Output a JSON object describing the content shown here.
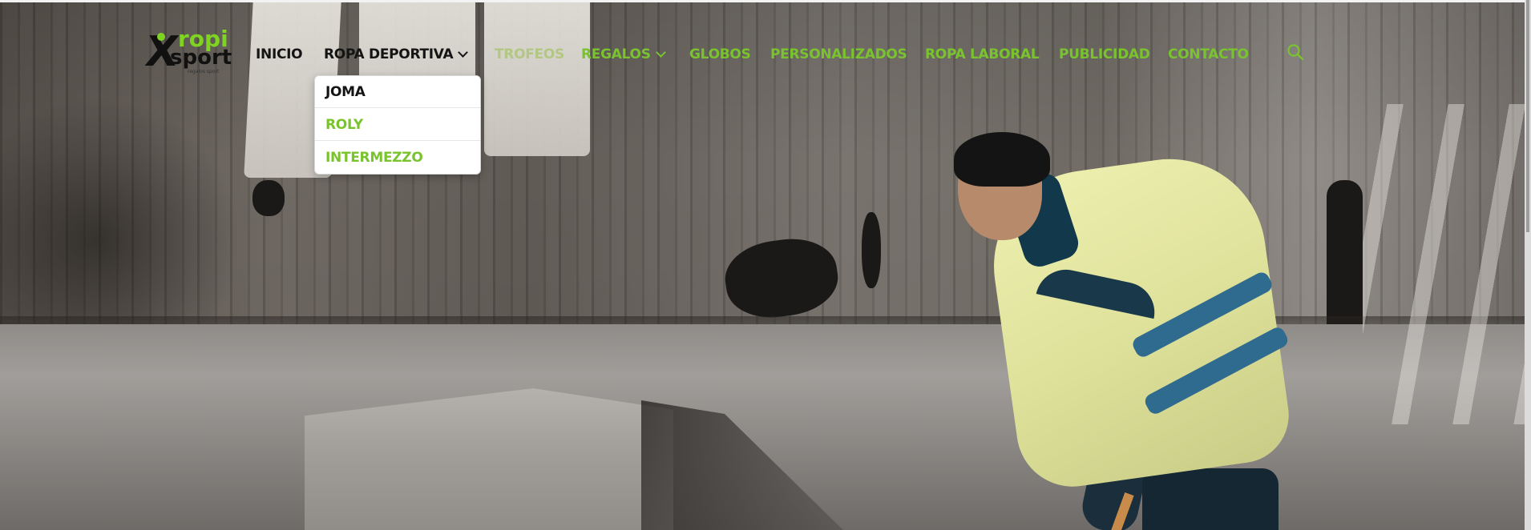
{
  "brand": {
    "logo_letter": "X",
    "logo_ropi": "ropi",
    "logo_sport": "sport",
    "logo_tagline": "regalos sport"
  },
  "nav": {
    "items": [
      {
        "label": "INICIO",
        "color": "#141414",
        "has_dropdown": false
      },
      {
        "label": "ROPA DEPORTIVA",
        "color": "#141414",
        "has_dropdown": true
      },
      {
        "label": "TROFEOS",
        "color": "#a7c46a",
        "has_dropdown": false
      },
      {
        "label": "REGALOS",
        "color": "#79c42e",
        "has_dropdown": true
      },
      {
        "label": "GLOBOS",
        "color": "#79c42e",
        "has_dropdown": false
      },
      {
        "label": "PERSONALIZADOS",
        "color": "#79c42e",
        "has_dropdown": false
      },
      {
        "label": "ROPA LABORAL",
        "color": "#79c42e",
        "has_dropdown": false
      },
      {
        "label": "PUBLICIDAD",
        "color": "#79c42e",
        "has_dropdown": false
      },
      {
        "label": "CONTACTO",
        "color": "#79c42e",
        "has_dropdown": false
      }
    ],
    "search_icon": "search-icon"
  },
  "dropdown": {
    "parent": "ROPA DEPORTIVA",
    "items": [
      {
        "label": "JOMA",
        "color": "#141414"
      },
      {
        "label": "ROLY",
        "color": "#79c42e"
      },
      {
        "label": "INTERMEZZO",
        "color": "#79c42e"
      }
    ]
  },
  "colors": {
    "accent_green": "#79c42e",
    "text_dark": "#141414"
  }
}
